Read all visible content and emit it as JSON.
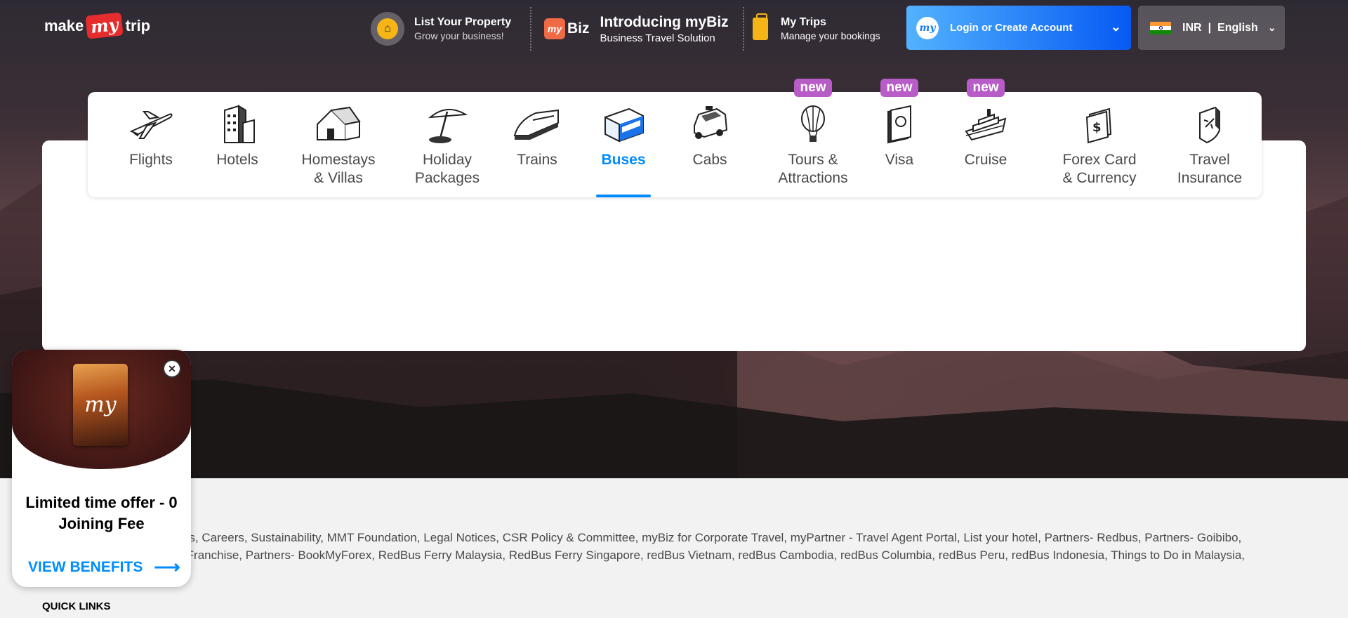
{
  "header": {
    "logo": {
      "make": "make",
      "my": "my",
      "trip": "trip"
    },
    "list_property": {
      "title": "List Your Property",
      "subtitle": "Grow your business!",
      "icon": "house-key-icon"
    },
    "mybiz": {
      "badge": "Biz",
      "badge_icon": "my",
      "title": "Introducing myBiz",
      "subtitle": "Business Travel Solution"
    },
    "my_trips": {
      "title": "My Trips",
      "subtitle": "Manage your bookings",
      "icon": "suitcase-icon"
    },
    "login": {
      "label": "Login or Create Account",
      "avatar": "my"
    },
    "locale": {
      "currency": "INR",
      "separator": "|",
      "language": "English"
    }
  },
  "nav": {
    "items": [
      {
        "label": "Flights",
        "icon": "flight-icon"
      },
      {
        "label": "Hotels",
        "icon": "hotel-icon"
      },
      {
        "label": "Homestays\n& Villas",
        "icon": "homestay-icon"
      },
      {
        "label": "Holiday\nPackages",
        "icon": "holiday-icon"
      },
      {
        "label": "Trains",
        "icon": "train-icon"
      },
      {
        "label": "Buses",
        "icon": "bus-icon",
        "active": true
      },
      {
        "label": "Cabs",
        "icon": "cab-icon"
      },
      {
        "label": "Tours &\nAttractions",
        "icon": "balloon-icon",
        "tag": "new"
      },
      {
        "label": "Visa",
        "icon": "passport-icon",
        "tag": "new"
      },
      {
        "label": "Cruise",
        "icon": "cruise-icon",
        "tag": "new"
      },
      {
        "label": "Forex Card\n& Currency",
        "icon": "forex-icon"
      },
      {
        "label": "Travel\nInsurance",
        "icon": "insurance-icon"
      }
    ]
  },
  "footer": {
    "links_line1": "ns, Careers, Sustainability, MMT Foundation, Legal Notices, CSR Policy & Committee, myBiz for Corporate Travel, myPartner - Travel Agent Portal, List your hotel, Partners- Redbus, Partners- Goibibo,",
    "links_line2": "-Franchise, Partners- BookMyForex, RedBus Ferry Malaysia, RedBus Ferry Singapore, redBus Vietnam, redBus Cambodia, redBus Columbia, redBus Peru, redBus Indonesia, Things to Do in Malaysia,",
    "quick_links": "QUICK LINKS"
  },
  "popup": {
    "card_text": "my",
    "offer_line1": "Limited time offer - 0",
    "offer_line2": "Joining Fee",
    "cta": "VIEW BENEFITS",
    "cta_arrow": "⟶",
    "close": "✕"
  },
  "colors": {
    "accent": "#008cff",
    "brand_red": "#e62c2c",
    "tag_purple": "#b85cc7",
    "login_gradient_start": "#53b2fe",
    "login_gradient_end": "#065af3"
  }
}
